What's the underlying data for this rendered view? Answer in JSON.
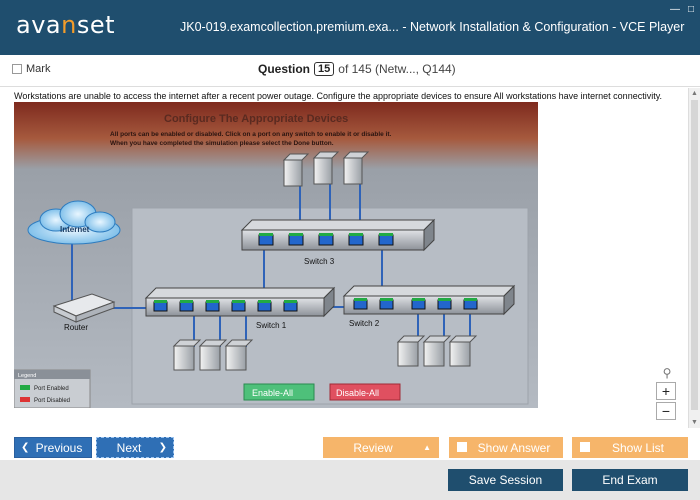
{
  "app": {
    "logo_left": "ava",
    "logo_accent": "n",
    "logo_right": "set",
    "title": "JK0-019.examcollection.premium.exa... - Network Installation & Configuration  - VCE Player"
  },
  "question_bar": {
    "mark_label": "Mark",
    "question_label": "Question",
    "question_number": "15",
    "question_rest": "of 145 (Netw..., Q144)"
  },
  "question": {
    "text": "Workstations are unable to access the internet after a recent power outage. Configure the appropriate devices to ensure All workstations have internet connectivity."
  },
  "simulation": {
    "heading": "Configure The Appropriate Devices",
    "instructions_1": "All ports can be enabled or disabled. Click on a port on any switch to enable it or disable it.",
    "instructions_2": "When you have completed the simulation please select the Done button.",
    "internet_label": "Internet",
    "router_label": "Router",
    "switch1_label": "Switch 1",
    "switch2_label": "Switch 2",
    "switch3_label": "Switch 3",
    "legend_title": "Legend",
    "legend_enabled": "Port Enabled",
    "legend_disabled": "Port Disabled",
    "enable_all": "Enable-All",
    "disable_all": "Disable-All",
    "colors": {
      "port_enabled": "#22aa44",
      "port_disabled": "#dd3333",
      "port_active": "#2266cc"
    }
  },
  "nav": {
    "previous": "Previous",
    "next": "Next",
    "review": "Review",
    "show_answer": "Show Answer",
    "show_list": "Show List"
  },
  "footer": {
    "save_session": "Save Session",
    "end_exam": "End Exam"
  }
}
